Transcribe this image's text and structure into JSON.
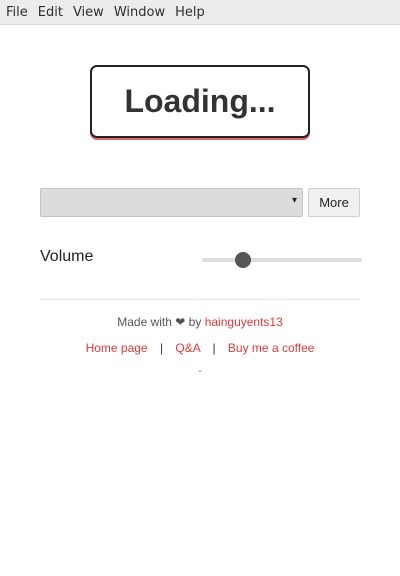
{
  "menu": {
    "items": [
      {
        "label": "File"
      },
      {
        "label": "Edit"
      },
      {
        "label": "View"
      },
      {
        "label": "Window"
      },
      {
        "label": "Help"
      }
    ]
  },
  "loading": {
    "text": "Loading..."
  },
  "controls": {
    "select_value": "",
    "caret_icon": "▾",
    "more_label": "More"
  },
  "volume": {
    "label": "Volume",
    "value": 0.23
  },
  "footer": {
    "made_with": "Made with",
    "heart": "❤",
    "by": "by",
    "author": "hainguyents13",
    "links": {
      "home": "Home page",
      "qa": "Q&A",
      "coffee": "Buy me a coffee",
      "separator": "|"
    },
    "dash": "-"
  },
  "colors": {
    "accent": "#e0383a",
    "shadow": "#e06666"
  }
}
